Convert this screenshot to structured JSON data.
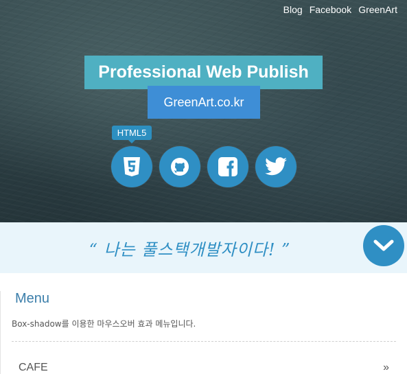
{
  "nav": {
    "links": [
      {
        "label": "Blog"
      },
      {
        "label": "Facebook"
      },
      {
        "label": "GreenArt"
      }
    ]
  },
  "hero": {
    "title": "Professional Web Publish",
    "site": "GreenArt.co.kr",
    "tooltip": "HTML5",
    "icons": [
      {
        "name": "html5-icon"
      },
      {
        "name": "github-icon"
      },
      {
        "name": "facebook-icon"
      },
      {
        "name": "twitter-icon"
      }
    ]
  },
  "quote": {
    "text": "“ 나는 풀스택개발자이다! ”"
  },
  "menu": {
    "title": "Menu",
    "description": "Box-shadow를 이용한 마우스오버 효과 메뉴입니다.",
    "items": [
      {
        "label": "CAFE",
        "chevron": "»"
      }
    ]
  },
  "colors": {
    "accent": "#2f8fc4",
    "title_bg": "#4fb0c2",
    "site_bg": "#3e8ed6",
    "quote_bg": "#e9f5fb"
  }
}
